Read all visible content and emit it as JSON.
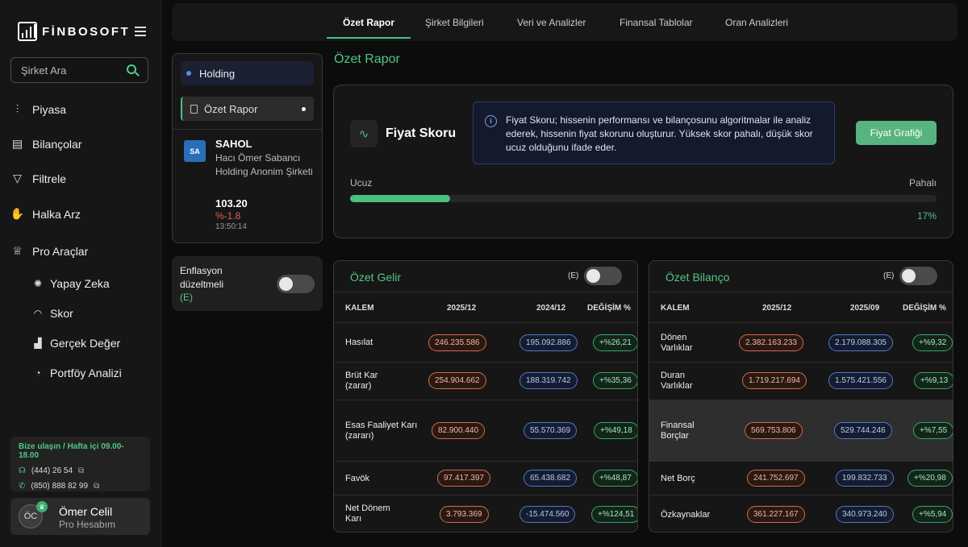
{
  "brand": {
    "name": "FİNBOSOFT"
  },
  "search": {
    "placeholder": "Şirket Ara"
  },
  "sidebar": {
    "items": [
      {
        "label": "Piyasa",
        "icon": "chart-icon"
      },
      {
        "label": "Bilançolar",
        "icon": "document-icon"
      },
      {
        "label": "Filtrele",
        "icon": "filter-icon"
      },
      {
        "label": "Halka Arz",
        "icon": "hand-icon"
      },
      {
        "label": "Pro Araçlar",
        "icon": "crown-icon"
      }
    ],
    "subitems": [
      {
        "label": "Yapay Zeka",
        "icon": "ai-icon"
      },
      {
        "label": "Skor",
        "icon": "gauge-icon"
      },
      {
        "label": "Gerçek Değer",
        "icon": "bars-icon"
      },
      {
        "label": "Portföy Analizi",
        "icon": "pie-icon"
      }
    ]
  },
  "contact": {
    "title": "Bize ulaşın / Hafta içi 09.00-18.00",
    "phone1": "(444) 26 54",
    "phone2": "(850) 888 82 99"
  },
  "user": {
    "initials": "ÖC",
    "name": "Ömer Celil",
    "plan": "Pro Hesabım"
  },
  "tabs": [
    "Özet Rapor",
    "Şirket Bilgileri",
    "Veri ve Analizler",
    "Finansal Tablolar",
    "Oran Analizleri"
  ],
  "left_panel": {
    "group": "Holding",
    "active_link": "Özet Rapor",
    "stock": {
      "logo_text": "SA",
      "code": "SAHOL",
      "name": "Hacı Ömer Sabancı Holding Anonim Şirketi",
      "price": "103.20",
      "change": "%-1.8",
      "time": "13:50:14"
    }
  },
  "inflation": {
    "label": "Enflasyon düzeltmeli",
    "tag": "(E)"
  },
  "page": {
    "title": "Özet Rapor"
  },
  "score": {
    "title": "Fiyat Skoru",
    "info": "Fiyat Skoru; hissenin performansı ve bilançosunu algoritmalar ile analiz ederek, hissenin fiyat skorunu oluşturur. Yüksek skor pahalı, düşük skor ucuz olduğunu ifade eder.",
    "button": "Fiyat Grafiği",
    "low_label": "Ucuz",
    "high_label": "Pahalı",
    "value_label": "17%",
    "value": 0.17
  },
  "income": {
    "title": "Özet Gelir",
    "tag": "(E)",
    "headers": [
      "KALEM",
      "2025/12",
      "2024/12",
      "DEĞİŞİM %"
    ],
    "rows": [
      {
        "label": "Hasılat",
        "v1": "246.235.586",
        "v2": "195.092.886",
        "chg": "+%26,21"
      },
      {
        "label": "Brüt Kar (zarar)",
        "v1": "254.904.662",
        "v2": "188.319.742",
        "chg": "+%35,36"
      },
      {
        "label": "Esas Faaliyet Karı (zararı)",
        "v1": "82.900.440",
        "v2": "55.570.369",
        "chg": "+%49,18"
      },
      {
        "label": "Favök",
        "v1": "97.417.397",
        "v2": "65.438.682",
        "chg": "+%48,87"
      },
      {
        "label": "Net Dönem Karı",
        "v1": "3.793.369",
        "v2": "-15.474.560",
        "chg": "+%124,51"
      }
    ]
  },
  "balance": {
    "title": "Özet Bilanço",
    "tag": "(E)",
    "headers": [
      "KALEM",
      "2025/12",
      "2025/09",
      "DEĞİŞİM %"
    ],
    "rows": [
      {
        "label": "Dönen Varlıklar",
        "v1": "2.382.163.233",
        "v2": "2.179.088.305",
        "chg": "+%9,32"
      },
      {
        "label": "Duran Varlıklar",
        "v1": "1.719.217.694",
        "v2": "1.575.421.556",
        "chg": "+%9,13"
      },
      {
        "label": "Finansal Borçlar",
        "v1": "569.753.806",
        "v2": "529.744.246",
        "chg": "+%7,55"
      },
      {
        "label": "Net Borç",
        "v1": "241.752.697",
        "v2": "199.832.733",
        "chg": "+%20,98"
      },
      {
        "label": "Özkaynaklar",
        "v1": "361.227.167",
        "v2": "340.973.240",
        "chg": "+%5,94"
      }
    ]
  }
}
